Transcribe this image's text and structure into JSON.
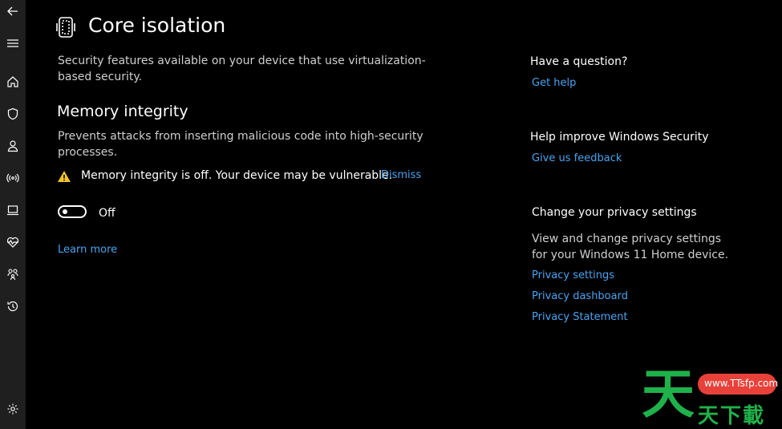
{
  "page": {
    "title": "Core isolation",
    "description": "Security features available on your device that use virtualization-based security."
  },
  "memory_integrity": {
    "title": "Memory integrity",
    "description": "Prevents attacks from inserting malicious code into high-security processes.",
    "warning": "Memory integrity is off. Your device may be vulnerable.",
    "dismiss": "Dismiss",
    "toggle_state": "Off",
    "learn_more": "Learn more"
  },
  "aside": {
    "question_heading": "Have a question?",
    "get_help": "Get help",
    "improve_heading": "Help improve Windows Security",
    "feedback": "Give us feedback",
    "privacy_heading": "Change your privacy settings",
    "privacy_text": "View and change privacy settings for your Windows 11 Home device.",
    "privacy_settings": "Privacy settings",
    "privacy_dashboard": "Privacy dashboard",
    "privacy_statement": "Privacy Statement"
  },
  "sidebar": {
    "icons": [
      "back-arrow-icon",
      "menu-icon",
      "home-icon",
      "shield-icon",
      "account-icon",
      "firewall-network-icon",
      "app-browser-control-icon",
      "device-security-icon",
      "device-health-icon",
      "family-options-icon",
      "protection-history-icon",
      "settings-gear-icon"
    ]
  },
  "watermark": {
    "big": "天",
    "url": "www.TTsfp.com",
    "small": "天下載"
  },
  "colors": {
    "background": "#000000",
    "sidebar": "#1f1f1f",
    "link": "#4aa3f0",
    "warning": "#f2c230",
    "watermark_green": "#1fb24a",
    "watermark_red": "#e8413a"
  }
}
